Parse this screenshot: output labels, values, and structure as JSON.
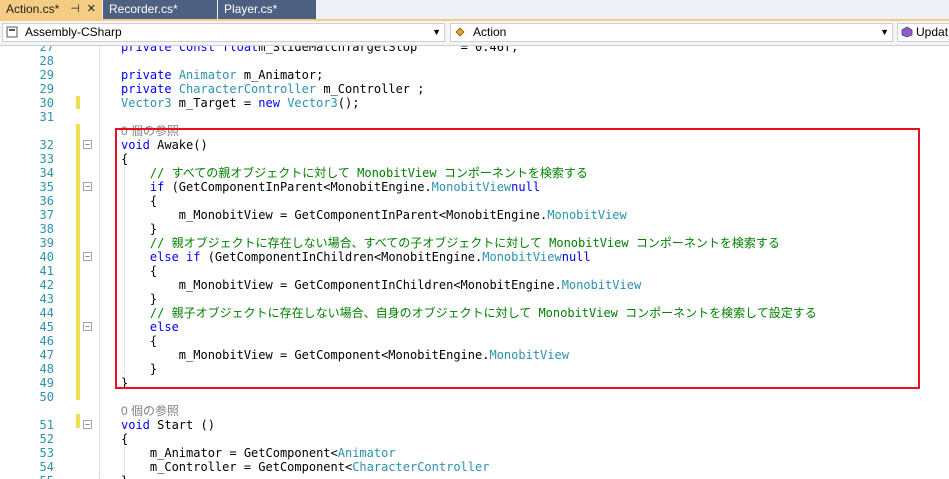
{
  "tabs": [
    {
      "label": "Action.cs*",
      "active": true
    },
    {
      "label": "Recorder.cs*",
      "active": false
    },
    {
      "label": "Player.cs*",
      "active": false
    }
  ],
  "navbar": {
    "project": "Assembly-CSharp",
    "type": "Action",
    "member": "Updat"
  },
  "colors": {
    "keyword": "#0000ff",
    "type": "#2b91af",
    "comment": "#008000",
    "highlight_box": "#e81123",
    "active_tab": "#f5cc84"
  },
  "lines": [
    {
      "n": "27",
      "segs": [
        [
          "kw",
          "private const float"
        ],
        [
          "",
          "m_SlideMatchTargetStop      = 0.46f;"
        ]
      ]
    },
    {
      "n": "28",
      "segs": []
    },
    {
      "n": "29",
      "segs": [
        [
          "kw",
          "private"
        ],
        [
          "",
          " "
        ],
        [
          "ty",
          "Animator"
        ],
        [
          "",
          " m_Animator;"
        ]
      ]
    },
    {
      "n": "29",
      "segs": [
        [
          "kw",
          "private"
        ],
        [
          "",
          " "
        ],
        [
          "ty",
          "CharacterController"
        ],
        [
          "",
          " m_Controller ;"
        ]
      ]
    },
    {
      "n": "30",
      "segs": [
        [
          "ty",
          "Vector3"
        ],
        [
          "",
          " m_Target = "
        ],
        [
          "kw",
          "new"
        ],
        [
          "",
          " "
        ],
        [
          "ty",
          "Vector3"
        ],
        [
          "",
          "();"
        ]
      ]
    },
    {
      "n": "31",
      "segs": []
    },
    {
      "n": "",
      "segs": [
        [
          "rf",
          "0 個の参照"
        ]
      ]
    },
    {
      "n": "32",
      "segs": [
        [
          "kw",
          "void"
        ],
        [
          "",
          " Awake()"
        ]
      ],
      "fold": true
    },
    {
      "n": "33",
      "segs": [
        [
          "",
          "{"
        ]
      ]
    },
    {
      "n": "34",
      "segs": [
        [
          "cm",
          "    // すべての親オブジェクトに対して MonobitView コンポーネントを検索する"
        ]
      ]
    },
    {
      "n": "35",
      "segs": [
        [
          "",
          "    "
        ],
        [
          "kw",
          "if"
        ],
        [
          "",
          " (GetComponentInParent<MonobitEngine."
        ],
        [
          "ty",
          "MonobitView"
        ],
        [
          ">() != "
        ],
        [
          "kw",
          "null"
        ],
        [
          ")"
        ]
      ],
      "fold": true
    },
    {
      "n": "36",
      "segs": [
        [
          "",
          "    {"
        ]
      ]
    },
    {
      "n": "37",
      "segs": [
        [
          "",
          "        m_MonobitView = GetComponentInParent<MonobitEngine."
        ],
        [
          "ty",
          "MonobitView"
        ],
        [
          ">();"
        ]
      ]
    },
    {
      "n": "38",
      "segs": [
        [
          "",
          "    }"
        ]
      ]
    },
    {
      "n": "39",
      "segs": [
        [
          "cm",
          "    // 親オブジェクトに存在しない場合、すべての子オブジェクトに対して MonobitView コンポーネントを検索する"
        ]
      ]
    },
    {
      "n": "40",
      "segs": [
        [
          "",
          "    "
        ],
        [
          "kw",
          "else if"
        ],
        [
          "",
          " (GetComponentInChildren<MonobitEngine."
        ],
        [
          "ty",
          "MonobitView"
        ],
        [
          ">() != "
        ],
        [
          "kw",
          "null"
        ],
        [
          ")"
        ]
      ],
      "fold": true
    },
    {
      "n": "41",
      "segs": [
        [
          "",
          "    {"
        ]
      ]
    },
    {
      "n": "42",
      "segs": [
        [
          "",
          "        m_MonobitView = GetComponentInChildren<MonobitEngine."
        ],
        [
          "ty",
          "MonobitView"
        ],
        [
          ">();"
        ]
      ]
    },
    {
      "n": "43",
      "segs": [
        [
          "",
          "    }"
        ]
      ]
    },
    {
      "n": "44",
      "segs": [
        [
          "cm",
          "    // 親子オブジェクトに存在しない場合、自身のオブジェクトに対して MonobitView コンポーネントを検索して設定する"
        ]
      ]
    },
    {
      "n": "45",
      "segs": [
        [
          "",
          "    "
        ],
        [
          "kw",
          "else"
        ]
      ],
      "fold": true
    },
    {
      "n": "46",
      "segs": [
        [
          "",
          "    {"
        ]
      ]
    },
    {
      "n": "47",
      "segs": [
        [
          "",
          "        m_MonobitView = GetComponent<MonobitEngine."
        ],
        [
          "ty",
          "MonobitView"
        ],
        [
          ">();"
        ]
      ]
    },
    {
      "n": "48",
      "segs": [
        [
          "",
          "    }"
        ]
      ]
    },
    {
      "n": "49",
      "segs": [
        [
          "",
          "}"
        ]
      ]
    },
    {
      "n": "50",
      "segs": []
    },
    {
      "n": "",
      "segs": [
        [
          "rf",
          "0 個の参照"
        ]
      ]
    },
    {
      "n": "51",
      "segs": [
        [
          "kw",
          "void"
        ],
        [
          "",
          " Start ()"
        ]
      ],
      "fold": true
    },
    {
      "n": "52",
      "segs": [
        [
          "",
          "{"
        ]
      ]
    },
    {
      "n": "53",
      "segs": [
        [
          "",
          "    m_Animator = GetComponent<"
        ],
        [
          "ty",
          "Animator"
        ],
        [
          ">();"
        ]
      ]
    },
    {
      "n": "54",
      "segs": [
        [
          "",
          "    m_Controller = GetComponent<"
        ],
        [
          "ty",
          "CharacterController"
        ],
        [
          ">();"
        ]
      ]
    },
    {
      "n": "55",
      "segs": [
        [
          "",
          "}"
        ]
      ]
    }
  ]
}
